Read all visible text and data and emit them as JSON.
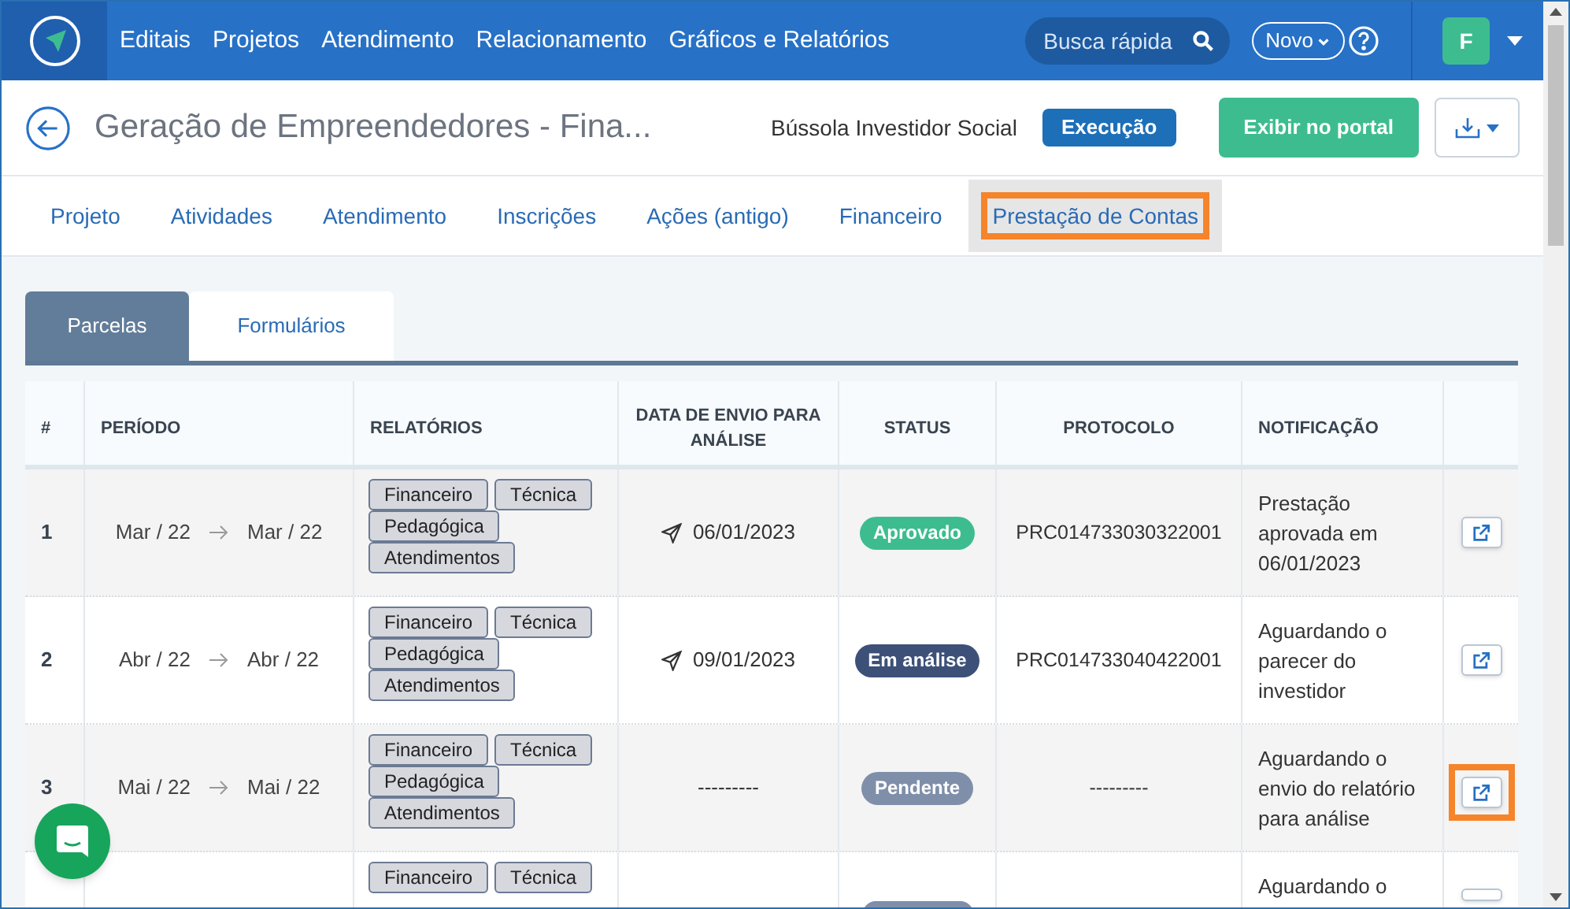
{
  "nav": {
    "items": [
      "Editais",
      "Projetos",
      "Atendimento",
      "Relacionamento",
      "Gráficos e Relatórios"
    ],
    "search": {
      "placeholder": "Busca rápida"
    },
    "new_button": "Novo",
    "avatar": "F"
  },
  "header": {
    "title": "Geração de Empreendedores - Fina...",
    "organization": "Bússola Investidor Social",
    "stage": "Execução",
    "portal_button": "Exibir no portal"
  },
  "tabs": [
    {
      "label": "Projeto",
      "selected": false,
      "highlighted": false
    },
    {
      "label": "Atividades",
      "selected": false,
      "highlighted": false
    },
    {
      "label": "Atendimento",
      "selected": false,
      "highlighted": false
    },
    {
      "label": "Inscrições",
      "selected": false,
      "highlighted": false
    },
    {
      "label": "Ações (antigo)",
      "selected": false,
      "highlighted": false
    },
    {
      "label": "Financeiro",
      "selected": false,
      "highlighted": false
    },
    {
      "label": "Prestação de Contas",
      "selected": true,
      "highlighted": true
    }
  ],
  "subtabs": [
    {
      "label": "Parcelas",
      "selected": true
    },
    {
      "label": "Formulários",
      "selected": false
    }
  ],
  "table": {
    "columns": [
      "#",
      "PERÍODO",
      "RELATÓRIOS",
      "DATA DE ENVIO PARA ANÁLISE",
      "STATUS",
      "PROTOCOLO",
      "NOTIFICAÇÃO"
    ],
    "rows": [
      {
        "number": "1",
        "from": "Mar / 22",
        "to": "Mar / 22",
        "reports": [
          "Financeiro",
          "Técnica",
          "Pedagógica",
          "Atendimentos"
        ],
        "sent": "06/01/2023",
        "status": {
          "label": "Aprovado",
          "kind": "approved"
        },
        "protocol": "PRC014733030322001",
        "notification": "Prestação aprovada em 06/01/2023",
        "action_highlighted": false
      },
      {
        "number": "2",
        "from": "Abr / 22",
        "to": "Abr / 22",
        "reports": [
          "Financeiro",
          "Técnica",
          "Pedagógica",
          "Atendimentos"
        ],
        "sent": "09/01/2023",
        "status": {
          "label": "Em análise",
          "kind": "review"
        },
        "protocol": "PRC014733040422001",
        "notification": "Aguardando o parecer do investidor",
        "action_highlighted": false
      },
      {
        "number": "3",
        "from": "Mai / 22",
        "to": "Mai / 22",
        "reports": [
          "Financeiro",
          "Técnica",
          "Pedagógica",
          "Atendimentos"
        ],
        "sent": "---------",
        "status": {
          "label": "Pendente",
          "kind": "pending"
        },
        "protocol": "---------",
        "notification": "Aguardando o envio do relatório para análise",
        "action_highlighted": true
      },
      {
        "reports": [
          "Financeiro",
          "Técnica"
        ],
        "status": {
          "kind": "pending"
        },
        "notification": "Aguardando o",
        "action_highlighted": false
      }
    ]
  }
}
